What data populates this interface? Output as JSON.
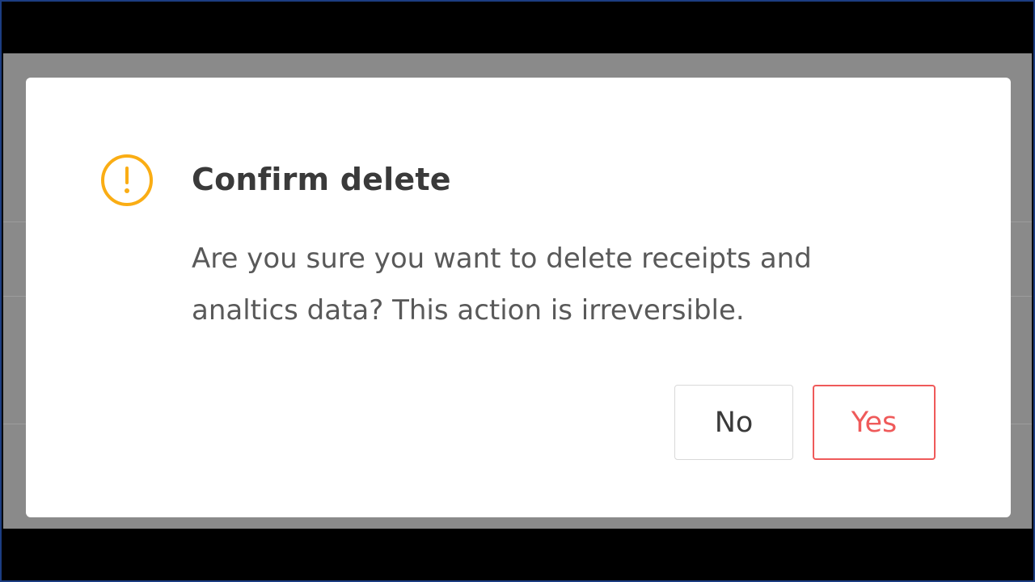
{
  "dialog": {
    "title": "Confirm delete",
    "message": "Are you sure you want to delete receipts and analtics data? This action is irreversible.",
    "icon": "exclamation-circle-icon",
    "buttons": {
      "no_label": "No",
      "yes_label": "Yes"
    }
  },
  "colors": {
    "warning_icon": "#faad14",
    "danger": "#ef5a5a",
    "backdrop": "#8a8a8a",
    "frame_border": "#1c3d82"
  }
}
